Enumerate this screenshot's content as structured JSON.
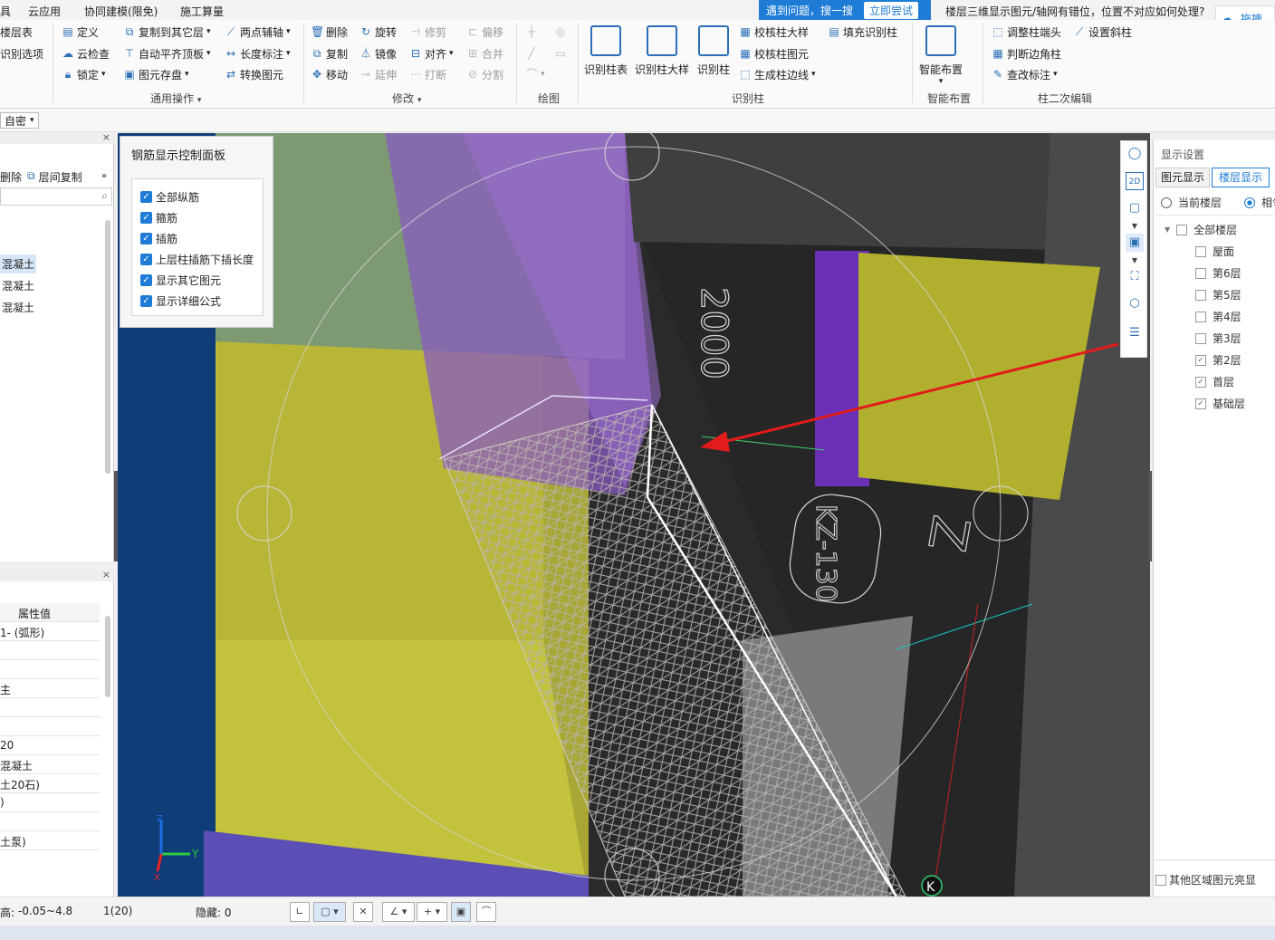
{
  "menubar": {
    "items": [
      "具",
      "云应用",
      "协同建模(限免)",
      "施工算量"
    ]
  },
  "notice": {
    "text": "遇到问题，搜一搜",
    "button": "立即尝试"
  },
  "help": {
    "text": "楼层三维显示图元/轴网有错位，位置不对应如何处理?"
  },
  "logo": {
    "label": "拖拽"
  },
  "ribbon": {
    "left_items": [
      "楼层表",
      "识别选项"
    ],
    "general_ops": {
      "group_label": "通用操作",
      "items": [
        "定义",
        "复制到其它层",
        "两点辅轴",
        "云检查",
        "自动平齐顶板",
        "长度标注",
        "锁定",
        "图元存盘",
        "转换图元"
      ]
    },
    "modify": {
      "group_label": "修改",
      "items": [
        "删除",
        "旋转",
        "修剪",
        "偏移",
        "复制",
        "镜像",
        "对齐",
        "合并",
        "移动",
        "延伸",
        "打断",
        "分割"
      ]
    },
    "draw": {
      "group_label": "绘图"
    },
    "recognize": {
      "group_label": "识别柱",
      "big": [
        "识别柱表",
        "识别柱大样",
        "识别柱"
      ],
      "items": [
        "校核柱大样",
        "填充识别柱",
        "校核柱图元",
        "生成柱边线"
      ]
    },
    "smart": {
      "group_label": "智能布置",
      "big": "智能布置"
    },
    "secondary": {
      "group_label": "柱二次编辑",
      "items": [
        "调整柱端头",
        "设置斜柱",
        "判断边角柱",
        "查改标注"
      ]
    }
  },
  "subbar": {
    "dropdown": "自密"
  },
  "leftpanel": {
    "toolbar": [
      "删除",
      "层间复制"
    ],
    "list": [
      "混凝土",
      "混凝土",
      "混凝土"
    ]
  },
  "proppanel": {
    "header": "属性值",
    "rows": [
      "1- (弧形)",
      "",
      "",
      "主",
      "",
      "",
      "20",
      "混凝土",
      "土20石)",
      ")",
      "",
      "土泵)"
    ]
  },
  "control_panel": {
    "title": "钢筋显示控制面板",
    "checks": [
      "全部纵筋",
      "箍筋",
      "插筋",
      "上层柱插筋下插长度",
      "显示其它图元",
      "显示详细公式"
    ]
  },
  "viewport": {
    "marks": [
      "2000",
      "KZ-130",
      "Z",
      "K"
    ],
    "axes": {
      "x": "X",
      "y": "Y",
      "z": "Z"
    }
  },
  "display": {
    "title": "显示设置",
    "tabs": [
      "图元显示",
      "楼层显示"
    ],
    "radios": [
      "当前楼层",
      "相邻"
    ],
    "tree": [
      {
        "label": "全部楼层",
        "checked": false
      },
      {
        "label": "屋面",
        "checked": false
      },
      {
        "label": "第6层",
        "checked": false
      },
      {
        "label": "第5层",
        "checked": false
      },
      {
        "label": "第4层",
        "checked": false
      },
      {
        "label": "第3层",
        "checked": false
      },
      {
        "label": "第2层",
        "checked": true
      },
      {
        "label": "首层",
        "checked": true
      },
      {
        "label": "基础层",
        "checked": true
      }
    ],
    "footer": "其他区域图元亮显"
  },
  "status": {
    "elev": "高:",
    "range": "-0.05~4.8",
    "count": "1(20)",
    "hidden": "隐藏: 0"
  }
}
